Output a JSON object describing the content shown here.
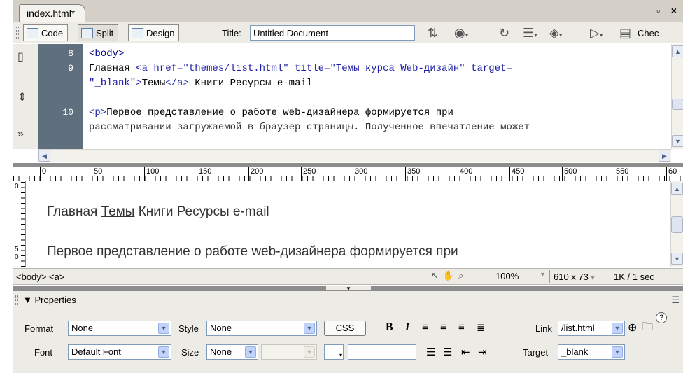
{
  "document": {
    "tab_title": "index.html*",
    "window_controls": "_ ▫ ×"
  },
  "toolbar": {
    "code_label": "Code",
    "split_label": "Split",
    "design_label": "Design",
    "title_label": "Title:",
    "title_value": "Untitled Document",
    "check_label": "Chec"
  },
  "code": {
    "line_numbers": [
      "8",
      "9",
      "10"
    ],
    "lines": {
      "l1": "<body>",
      "l2a": "Главная ",
      "l2b": "<a href=\"themes/list.html\" title=\"Темы курса Web-дизайн\" target=",
      "l3a": "\"_blank\">",
      "l3b": "Темы",
      "l3c": "</a>",
      "l3d": " Книги Ресурсы e-mail",
      "l4a": "<p>",
      "l4b": "Первое представление о работе web-дизайнера формируется при",
      "l5": "рассматривании загружаемой в браузер страницы. Полученное впечатление может"
    }
  },
  "ruler": {
    "marks": [
      "0",
      "50",
      "100",
      "150",
      "200",
      "250",
      "300",
      "350",
      "400",
      "450",
      "500",
      "550",
      "60"
    ],
    "vertical": [
      "0",
      "5",
      "0"
    ]
  },
  "design": {
    "nav_home": "Главная",
    "nav_themes": "Темы",
    "nav_rest": "Книги Ресурсы e-mail",
    "paragraph": "Первое представление о работе web-дизайнера формируется при"
  },
  "status": {
    "tag_selector": "<body> <a>",
    "zoom": "100%",
    "window_size": "610 x 73",
    "download": "1K / 1 sec"
  },
  "properties": {
    "title": "Properties",
    "format_label": "Format",
    "format_value": "None",
    "style_label": "Style",
    "style_value": "None",
    "css_label": "CSS",
    "bold": "B",
    "italic": "I",
    "link_label": "Link",
    "link_value": "/list.html",
    "font_label": "Font",
    "font_value": "Default Font",
    "size_label": "Size",
    "size_value": "None",
    "target_label": "Target",
    "target_value": "_blank"
  }
}
